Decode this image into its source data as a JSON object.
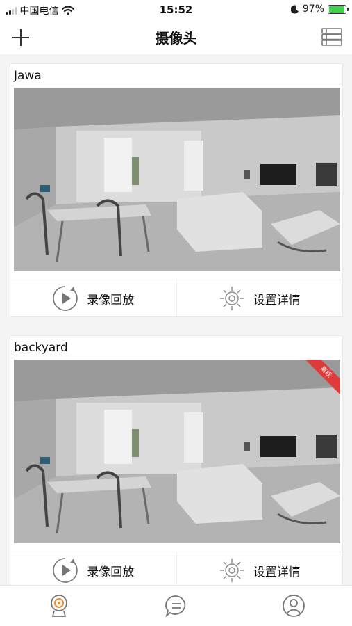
{
  "status_bar": {
    "carrier": "中国电信",
    "time": "15:52",
    "battery": "97%",
    "battery_level": 0.97,
    "icons": [
      "signal-icon",
      "wifi-icon",
      "moon-icon",
      "battery-charging-icon"
    ]
  },
  "nav": {
    "title": "摄像头",
    "left_icon": "plus-icon",
    "right_icon": "list-icon"
  },
  "cameras": [
    {
      "name": "Jawa",
      "offline_label": "",
      "playback_label": "录像回放",
      "settings_label": "设置详情"
    },
    {
      "name": "backyard",
      "offline_label": "离线",
      "playback_label": "录像回放",
      "settings_label": "设置详情"
    }
  ],
  "tab_bar": {
    "tabs": [
      {
        "icon": "camera-icon",
        "active": true
      },
      {
        "icon": "message-icon",
        "active": false
      },
      {
        "icon": "user-icon",
        "active": false
      }
    ]
  },
  "colors": {
    "accent": "#f08c2a",
    "offline_badge": "#e03b3b",
    "icon_gray": "#777777"
  }
}
